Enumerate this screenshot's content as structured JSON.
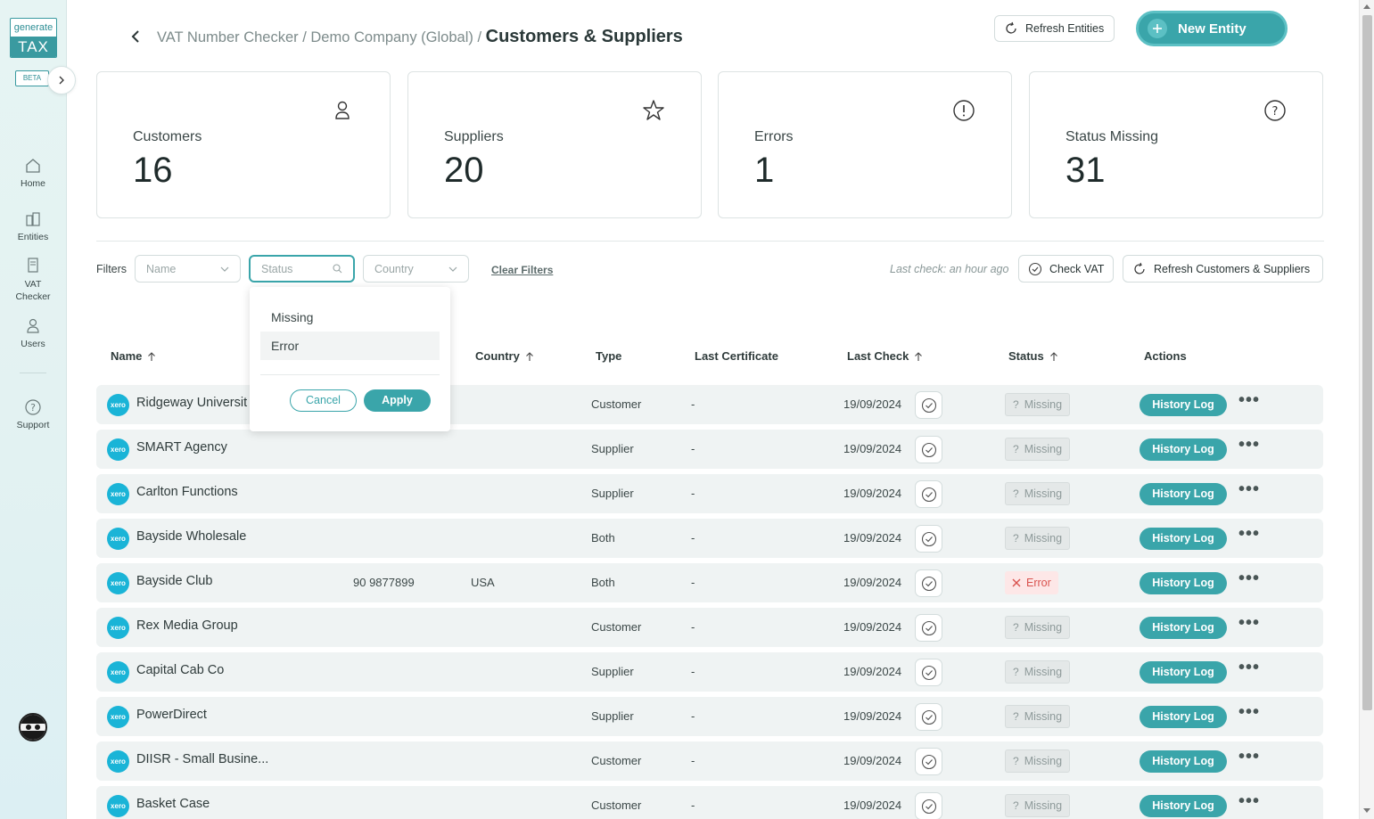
{
  "sidebar": {
    "logo_top": "generate",
    "logo_bottom": "TAX",
    "beta": "BETA",
    "items": [
      {
        "label": "Home"
      },
      {
        "label": "Entities"
      },
      {
        "label": "VAT Checker"
      },
      {
        "label": "Users"
      },
      {
        "label": "Support"
      }
    ]
  },
  "header": {
    "breadcrumb_parent": "VAT Number Checker / Demo Company (Global) /",
    "breadcrumb_current": "Customers & Suppliers",
    "refresh_entities_label": "Refresh Entities",
    "new_entity_label": "New Entity"
  },
  "stats": [
    {
      "label": "Customers",
      "value": "16",
      "icon": "user-icon"
    },
    {
      "label": "Suppliers",
      "value": "20",
      "icon": "star-icon"
    },
    {
      "label": "Errors",
      "value": "1",
      "icon": "exclamation-circle-icon"
    },
    {
      "label": "Status Missing",
      "value": "31",
      "icon": "question-circle-icon"
    }
  ],
  "filters": {
    "label": "Filters",
    "name_placeholder": "Name",
    "status_placeholder": "Status",
    "country_placeholder": "Country",
    "clear_label": "Clear Filters",
    "last_check": "Last check: an hour ago",
    "check_vat_label": "Check VAT",
    "refresh_label": "Refresh Customers & Suppliers"
  },
  "status_dropdown": {
    "options": [
      "Missing",
      "Error"
    ],
    "cancel_label": "Cancel",
    "apply_label": "Apply"
  },
  "table": {
    "headers": {
      "name": "Name",
      "country": "Country",
      "type": "Type",
      "last_certificate": "Last Certificate",
      "last_check": "Last Check",
      "status": "Status",
      "actions": "Actions"
    },
    "history_label": "History Log",
    "xero_label": "xero",
    "rows": [
      {
        "name": "Ridgeway Universit",
        "vat": "",
        "country": "",
        "type": "Customer",
        "certificate": "-",
        "last_check": "19/09/2024",
        "status": "Missing"
      },
      {
        "name": "SMART Agency",
        "vat": "",
        "country": "",
        "type": "Supplier",
        "certificate": "-",
        "last_check": "19/09/2024",
        "status": "Missing"
      },
      {
        "name": "Carlton Functions",
        "vat": "",
        "country": "",
        "type": "Supplier",
        "certificate": "-",
        "last_check": "19/09/2024",
        "status": "Missing"
      },
      {
        "name": "Bayside Wholesale",
        "vat": "",
        "country": "",
        "type": "Both",
        "certificate": "-",
        "last_check": "19/09/2024",
        "status": "Missing"
      },
      {
        "name": "Bayside Club",
        "vat": "90 9877899",
        "country": "USA",
        "type": "Both",
        "certificate": "-",
        "last_check": "19/09/2024",
        "status": "Error"
      },
      {
        "name": "Rex Media Group",
        "vat": "",
        "country": "",
        "type": "Customer",
        "certificate": "-",
        "last_check": "19/09/2024",
        "status": "Missing"
      },
      {
        "name": "Capital Cab Co",
        "vat": "",
        "country": "",
        "type": "Supplier",
        "certificate": "-",
        "last_check": "19/09/2024",
        "status": "Missing"
      },
      {
        "name": "PowerDirect",
        "vat": "",
        "country": "",
        "type": "Supplier",
        "certificate": "-",
        "last_check": "19/09/2024",
        "status": "Missing"
      },
      {
        "name": "DIISR - Small Busine...",
        "vat": "",
        "country": "",
        "type": "Customer",
        "certificate": "-",
        "last_check": "19/09/2024",
        "status": "Missing"
      },
      {
        "name": "Basket Case",
        "vat": "",
        "country": "",
        "type": "Customer",
        "certificate": "-",
        "last_check": "19/09/2024",
        "status": "Missing"
      }
    ]
  },
  "colors": {
    "accent": "#3aa5aa",
    "error": "#d9534f",
    "xero": "#1ab4d7"
  }
}
